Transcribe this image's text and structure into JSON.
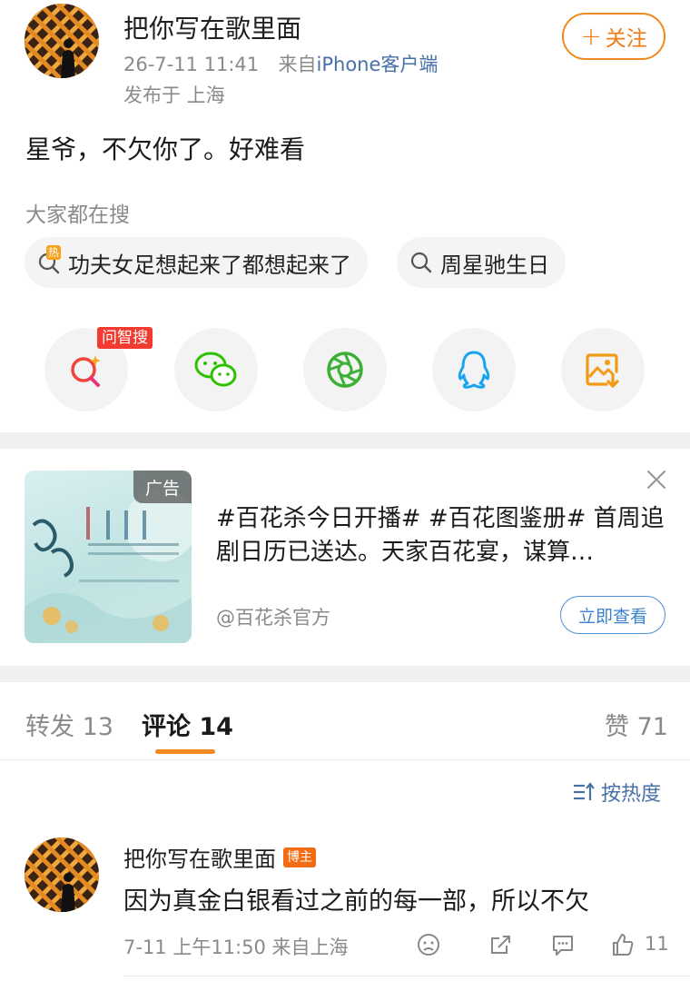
{
  "post": {
    "author": "把你写在歌里面",
    "time": "26-7-11 11:41",
    "source_prefix": "来自",
    "source": "iPhone客户端",
    "location": "发布于 上海",
    "follow_label": "关注",
    "follow_plus": "+",
    "text": "星爷，不欠你了。好难看"
  },
  "trending": {
    "title": "大家都在搜",
    "hot_badge": "热",
    "items": [
      "功夫女足想起来了都想起来了",
      "周星驰生日"
    ]
  },
  "share": {
    "ai_badge": "问智搜",
    "icons": [
      "ai-search-icon",
      "wechat-icon",
      "moments-icon",
      "qq-icon",
      "save-image-icon"
    ]
  },
  "ad": {
    "tag": "广告",
    "text": "#百花杀今日开播# #百花图鉴册# 首周追剧日历已送达。天家百花宴，谋算…",
    "account": "@百花杀官方",
    "cta": "立即查看"
  },
  "tabs": {
    "repost": "转发 13",
    "comments": "评论 14",
    "likes": "赞 71"
  },
  "sort": {
    "label": "按热度"
  },
  "comment": {
    "author": "把你写在歌里面",
    "badge": "博主",
    "text": "因为真金白银看过之前的每一部，所以不欠",
    "meta": "7-11 上午11:50 来自上海",
    "like_count": "11"
  },
  "colors": {
    "accent_orange": "#f08a1f",
    "link_blue": "#4670a8",
    "hot_red": "#f23b2e",
    "wechat_green": "#2dc100",
    "qq_blue": "#1aa4ee"
  }
}
